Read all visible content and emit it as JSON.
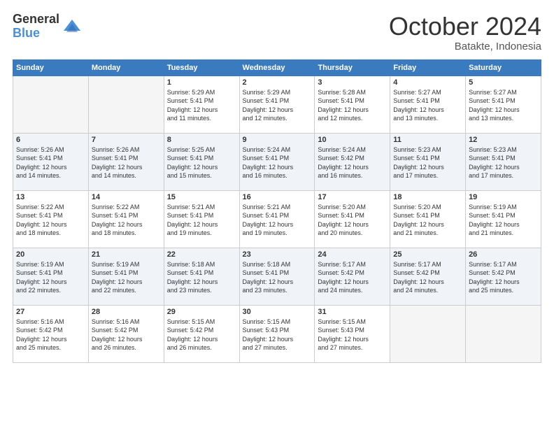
{
  "header": {
    "logo_general": "General",
    "logo_blue": "Blue",
    "month": "October 2024",
    "location": "Batakte, Indonesia"
  },
  "weekdays": [
    "Sunday",
    "Monday",
    "Tuesday",
    "Wednesday",
    "Thursday",
    "Friday",
    "Saturday"
  ],
  "weeks": [
    [
      {
        "day": "",
        "info": ""
      },
      {
        "day": "",
        "info": ""
      },
      {
        "day": "1",
        "info": "Sunrise: 5:29 AM\nSunset: 5:41 PM\nDaylight: 12 hours\nand 11 minutes."
      },
      {
        "day": "2",
        "info": "Sunrise: 5:29 AM\nSunset: 5:41 PM\nDaylight: 12 hours\nand 12 minutes."
      },
      {
        "day": "3",
        "info": "Sunrise: 5:28 AM\nSunset: 5:41 PM\nDaylight: 12 hours\nand 12 minutes."
      },
      {
        "day": "4",
        "info": "Sunrise: 5:27 AM\nSunset: 5:41 PM\nDaylight: 12 hours\nand 13 minutes."
      },
      {
        "day": "5",
        "info": "Sunrise: 5:27 AM\nSunset: 5:41 PM\nDaylight: 12 hours\nand 13 minutes."
      }
    ],
    [
      {
        "day": "6",
        "info": "Sunrise: 5:26 AM\nSunset: 5:41 PM\nDaylight: 12 hours\nand 14 minutes."
      },
      {
        "day": "7",
        "info": "Sunrise: 5:26 AM\nSunset: 5:41 PM\nDaylight: 12 hours\nand 14 minutes."
      },
      {
        "day": "8",
        "info": "Sunrise: 5:25 AM\nSunset: 5:41 PM\nDaylight: 12 hours\nand 15 minutes."
      },
      {
        "day": "9",
        "info": "Sunrise: 5:24 AM\nSunset: 5:41 PM\nDaylight: 12 hours\nand 16 minutes."
      },
      {
        "day": "10",
        "info": "Sunrise: 5:24 AM\nSunset: 5:42 PM\nDaylight: 12 hours\nand 16 minutes."
      },
      {
        "day": "11",
        "info": "Sunrise: 5:23 AM\nSunset: 5:41 PM\nDaylight: 12 hours\nand 17 minutes."
      },
      {
        "day": "12",
        "info": "Sunrise: 5:23 AM\nSunset: 5:41 PM\nDaylight: 12 hours\nand 17 minutes."
      }
    ],
    [
      {
        "day": "13",
        "info": "Sunrise: 5:22 AM\nSunset: 5:41 PM\nDaylight: 12 hours\nand 18 minutes."
      },
      {
        "day": "14",
        "info": "Sunrise: 5:22 AM\nSunset: 5:41 PM\nDaylight: 12 hours\nand 18 minutes."
      },
      {
        "day": "15",
        "info": "Sunrise: 5:21 AM\nSunset: 5:41 PM\nDaylight: 12 hours\nand 19 minutes."
      },
      {
        "day": "16",
        "info": "Sunrise: 5:21 AM\nSunset: 5:41 PM\nDaylight: 12 hours\nand 19 minutes."
      },
      {
        "day": "17",
        "info": "Sunrise: 5:20 AM\nSunset: 5:41 PM\nDaylight: 12 hours\nand 20 minutes."
      },
      {
        "day": "18",
        "info": "Sunrise: 5:20 AM\nSunset: 5:41 PM\nDaylight: 12 hours\nand 21 minutes."
      },
      {
        "day": "19",
        "info": "Sunrise: 5:19 AM\nSunset: 5:41 PM\nDaylight: 12 hours\nand 21 minutes."
      }
    ],
    [
      {
        "day": "20",
        "info": "Sunrise: 5:19 AM\nSunset: 5:41 PM\nDaylight: 12 hours\nand 22 minutes."
      },
      {
        "day": "21",
        "info": "Sunrise: 5:19 AM\nSunset: 5:41 PM\nDaylight: 12 hours\nand 22 minutes."
      },
      {
        "day": "22",
        "info": "Sunrise: 5:18 AM\nSunset: 5:41 PM\nDaylight: 12 hours\nand 23 minutes."
      },
      {
        "day": "23",
        "info": "Sunrise: 5:18 AM\nSunset: 5:41 PM\nDaylight: 12 hours\nand 23 minutes."
      },
      {
        "day": "24",
        "info": "Sunrise: 5:17 AM\nSunset: 5:42 PM\nDaylight: 12 hours\nand 24 minutes."
      },
      {
        "day": "25",
        "info": "Sunrise: 5:17 AM\nSunset: 5:42 PM\nDaylight: 12 hours\nand 24 minutes."
      },
      {
        "day": "26",
        "info": "Sunrise: 5:17 AM\nSunset: 5:42 PM\nDaylight: 12 hours\nand 25 minutes."
      }
    ],
    [
      {
        "day": "27",
        "info": "Sunrise: 5:16 AM\nSunset: 5:42 PM\nDaylight: 12 hours\nand 25 minutes."
      },
      {
        "day": "28",
        "info": "Sunrise: 5:16 AM\nSunset: 5:42 PM\nDaylight: 12 hours\nand 26 minutes."
      },
      {
        "day": "29",
        "info": "Sunrise: 5:15 AM\nSunset: 5:42 PM\nDaylight: 12 hours\nand 26 minutes."
      },
      {
        "day": "30",
        "info": "Sunrise: 5:15 AM\nSunset: 5:43 PM\nDaylight: 12 hours\nand 27 minutes."
      },
      {
        "day": "31",
        "info": "Sunrise: 5:15 AM\nSunset: 5:43 PM\nDaylight: 12 hours\nand 27 minutes."
      },
      {
        "day": "",
        "info": ""
      },
      {
        "day": "",
        "info": ""
      }
    ]
  ]
}
